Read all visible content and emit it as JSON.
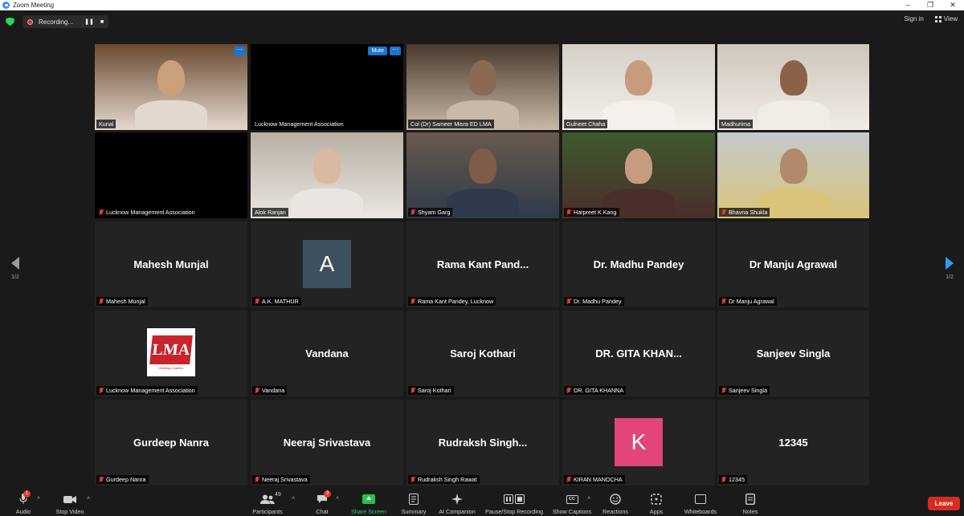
{
  "window": {
    "title": "Zoom Meeting",
    "controls": [
      "–",
      "❐",
      "✕"
    ]
  },
  "topbar": {
    "recording_label": "Recording...",
    "pause_symbol": "❚❚",
    "stop_symbol": "■",
    "signin": "Sign in",
    "view": "View"
  },
  "pager": {
    "label": "1/2"
  },
  "tiles": [
    {
      "name": "Kunal",
      "muted": false,
      "kind": "video"
    },
    {
      "name": "Lucknow Management Association",
      "muted": false,
      "kind": "black",
      "mute_button": "Mute"
    },
    {
      "name": "Col (Dr) Sameer Misra ED LMA",
      "muted": false,
      "kind": "video"
    },
    {
      "name": "Gulneet Chaha",
      "muted": false,
      "kind": "video"
    },
    {
      "name": "Madhurima",
      "muted": false,
      "kind": "video"
    },
    {
      "name": "Lucknow Management Association",
      "muted": true,
      "kind": "black"
    },
    {
      "name": "Alok Ranjan",
      "muted": false,
      "kind": "video"
    },
    {
      "name": "Shyam Garg",
      "muted": true,
      "kind": "video"
    },
    {
      "name": "Harpreet K Kang",
      "muted": true,
      "kind": "video"
    },
    {
      "name": "Bhavna Shukla",
      "muted": true,
      "kind": "video"
    },
    {
      "name": "Mahesh Munjal",
      "display": "Mahesh Munjal",
      "muted": true,
      "kind": "name"
    },
    {
      "name": "A.K. MATHUR",
      "avatar": "A",
      "avatar_color": "#3e4f5e",
      "muted": true,
      "kind": "avatar"
    },
    {
      "name": "Rama Kant Pandey, Lucknow",
      "display": "Rama Kant Pand...",
      "muted": true,
      "kind": "name"
    },
    {
      "name": "Dr. Madhu Pandey",
      "display": "Dr. Madhu Pandey",
      "muted": true,
      "kind": "name"
    },
    {
      "name": "Dr Manju Agrawal",
      "display": "Dr Manju Agrawal",
      "muted": true,
      "kind": "name"
    },
    {
      "name": "Lucknow Management Association",
      "logo": "LMA",
      "logo_tag": "Building Leaders",
      "muted": true,
      "kind": "logo"
    },
    {
      "name": "Vandana",
      "display": "Vandana",
      "muted": true,
      "kind": "name"
    },
    {
      "name": "Saroj Kothari",
      "display": "Saroj Kothari",
      "muted": true,
      "kind": "name"
    },
    {
      "name": "DR. GITA KHANNA",
      "display": "DR. GITA KHAN...",
      "muted": true,
      "kind": "name"
    },
    {
      "name": "Sanjeev Singla",
      "display": "Sanjeev Singla",
      "muted": true,
      "kind": "name"
    },
    {
      "name": "Gurdeep Nanra",
      "display": "Gurdeep Nanra",
      "muted": true,
      "kind": "name"
    },
    {
      "name": "Neeraj Srivastava",
      "display": "Neeraj Srivastava",
      "muted": true,
      "kind": "name"
    },
    {
      "name": "Rudraksh Singh Rawat",
      "display": "Rudraksh Singh...",
      "muted": true,
      "kind": "name"
    },
    {
      "name": "KIRAN MANOCHA",
      "avatar": "K",
      "avatar_color": "#e2457a",
      "muted": true,
      "kind": "avatar"
    },
    {
      "name": "12345",
      "display": "12345",
      "muted": true,
      "kind": "name"
    }
  ],
  "toolbar": {
    "audio": "Audio",
    "stop_video": "Stop Video",
    "participants": "Participants",
    "participants_count": "49",
    "chat": "Chat",
    "chat_badge": "3",
    "audio_badge": "1",
    "share_screen": "Share Screen",
    "summary": "Summary",
    "ai_companion": "AI Companion",
    "pause_stop_recording": "Pause/Stop Recording",
    "show_captions": "Show Captions",
    "reactions": "Reactions",
    "apps": "Apps",
    "whiteboards": "Whiteboards",
    "notes": "Notes",
    "leave": "Leave"
  }
}
